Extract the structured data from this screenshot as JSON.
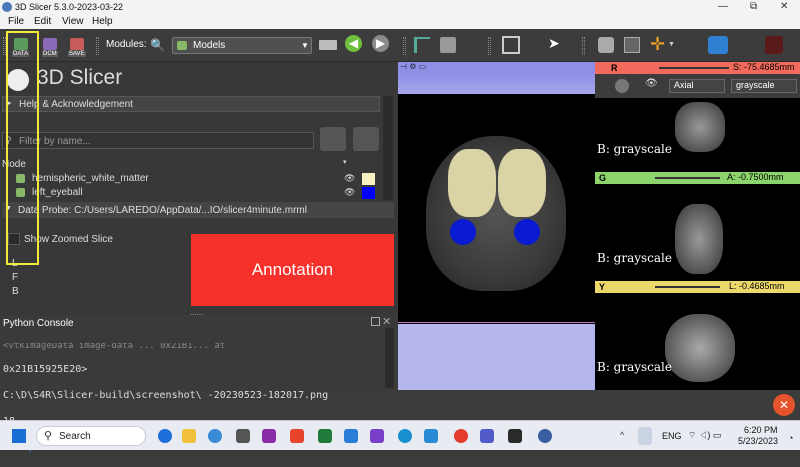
{
  "window": {
    "title": "3D Slicer 5.3.0-2023-03-22",
    "min": "—",
    "max": "⧉",
    "close": "✕"
  },
  "menu": [
    "File",
    "Edit",
    "View",
    "Help"
  ],
  "toolbar": {
    "data_label": "DATA",
    "dcm_label": "DCM",
    "save_label": "SAVE",
    "modules_label": "Modules:",
    "module_value": "Models"
  },
  "leftpanel": {
    "logo_text": "3D Slicer",
    "help_label": "Help & Acknowledgement",
    "filter_placeholder": "Filter by name...",
    "node_header": "Node",
    "nodes": [
      {
        "name": "hemispheric_white_matter",
        "color": "#f7f0c0"
      },
      {
        "name": "left_eyeball",
        "color": "#0000ff"
      }
    ],
    "data_probe": "Data Probe: C:/Users/LAREDO/AppData/...IO/slicer4minute.mrml",
    "show_zoomed": "Show Zoomed Slice",
    "probe_lines": [
      "L",
      "F",
      "B"
    ]
  },
  "annotation": "Annotation",
  "python": {
    "title": "Python Console",
    "lines": [
      "0x21B15925E20>",
      "C:\\D\\S4R\\Slicer-build\\screenshot\\ -20230523-182017.png",
      "18",
      ">>> |"
    ],
    "cutoff_line": "<vtkImageData image-data ... 0x21B1... at"
  },
  "views": {
    "axial_label": "S",
    "red": {
      "letter": "R",
      "value": "S: -75.4685mm",
      "orient": "Axial",
      "bg": "grayscale",
      "caption": "B: grayscale"
    },
    "green": {
      "letter": "G",
      "value": "A: -0.7500mm",
      "caption": "B: grayscale"
    },
    "yellow": {
      "letter": "Y",
      "value": "L: -0.4685mm",
      "caption": "B: grayscale"
    },
    "colors": {
      "red": "#f26a5c",
      "green": "#8bd46b",
      "yellow": "#ecd86a",
      "blue": "#8f8fe6"
    }
  },
  "taskbar": {
    "search": "Search",
    "lang": "ENG",
    "time": "6:20 PM",
    "date": "5/23/2023"
  }
}
